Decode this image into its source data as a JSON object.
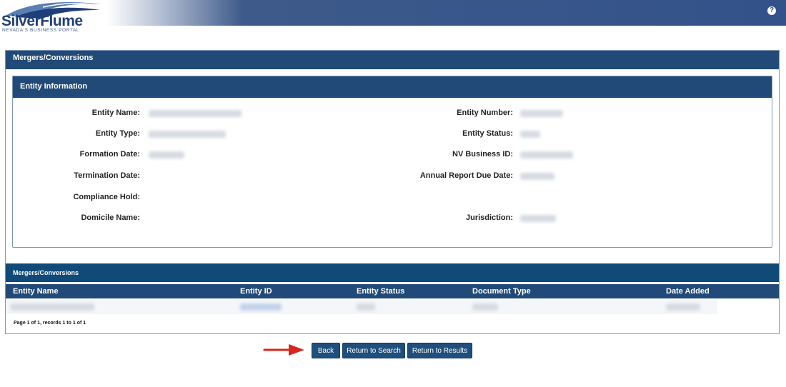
{
  "header": {
    "logo_main": "SilverFlume",
    "logo_sub": "NEVADA'S BUSINESS PORTAL",
    "help_icon": "question-circle-icon"
  },
  "outer_panel": {
    "title": "Mergers/Conversions"
  },
  "entity_info": {
    "title": "Entity Information",
    "left_labels": [
      "Entity Name:",
      "Entity Type:",
      "Formation Date:",
      "Termination Date:",
      "Compliance Hold:",
      "Domicile Name:"
    ],
    "right_labels": [
      "Entity Number:",
      "Entity Status:",
      "NV Business ID:",
      "Annual Report Due Date:",
      "Jurisdiction:"
    ]
  },
  "mergers": {
    "title": "Mergers/Conversions",
    "columns": [
      "Entity Name",
      "Entity ID",
      "Entity Status",
      "Document Type",
      "Date Added"
    ],
    "pager_text": "Page 1 of 1, records 1 to 1 of 1"
  },
  "buttons": {
    "back": "Back",
    "return_search": "Return to Search",
    "return_results": "Return to Results"
  },
  "colors": {
    "header_blue": "#33528a",
    "panel_blue": "#224a78",
    "button_blue": "#1f4f7d",
    "arrow_red": "#d9261c"
  }
}
